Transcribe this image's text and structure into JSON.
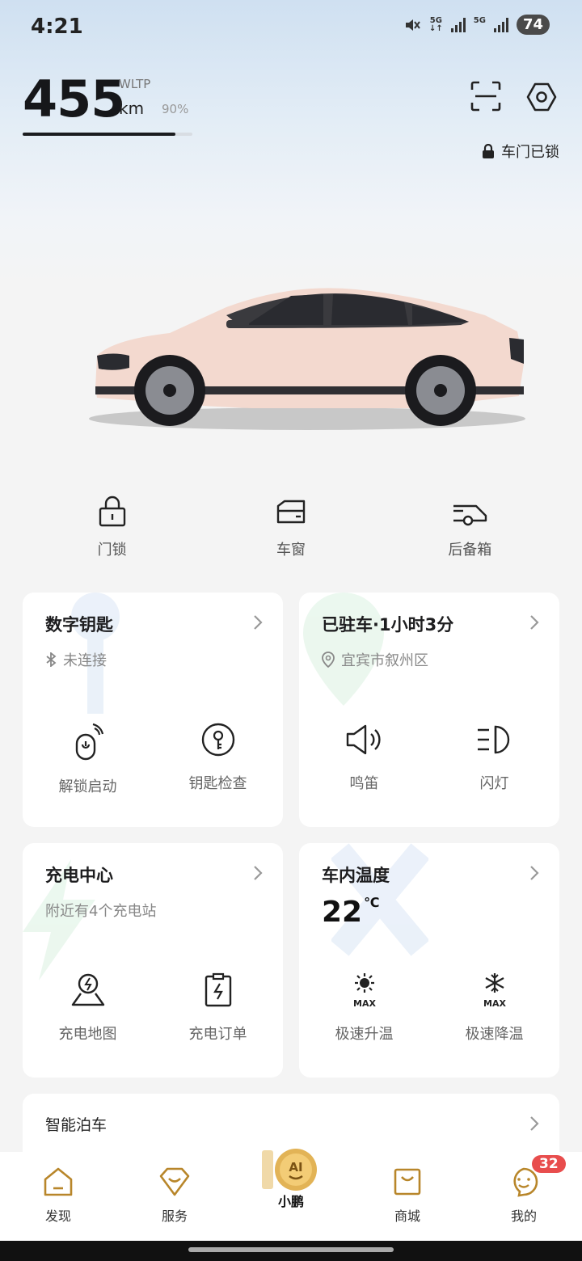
{
  "status": {
    "time": "4:21",
    "network1": "5G",
    "network2": "5G",
    "battery": "74"
  },
  "range": {
    "value": "455",
    "standard": "WLTP",
    "unit": "km",
    "percent": "90%",
    "fill": 0.9
  },
  "door_status": "车门已锁",
  "quick_controls": [
    {
      "label": "门锁",
      "icon": "lock-icon"
    },
    {
      "label": "车窗",
      "icon": "window-icon"
    },
    {
      "label": "后备箱",
      "icon": "trunk-icon"
    }
  ],
  "cards": {
    "digital_key": {
      "title": "数字钥匙",
      "status": "未连接",
      "actions": [
        {
          "label": "解锁启动",
          "icon": "remote-unlock-icon"
        },
        {
          "label": "钥匙检查",
          "icon": "key-check-icon"
        }
      ]
    },
    "parking": {
      "title": "已驻车·1小时3分",
      "location": "宜宾市叙州区",
      "actions": [
        {
          "label": "鸣笛",
          "icon": "horn-icon"
        },
        {
          "label": "闪灯",
          "icon": "headlight-icon"
        }
      ]
    },
    "charging": {
      "title": "充电中心",
      "subtitle": "附近有4个充电站",
      "actions": [
        {
          "label": "充电地图",
          "icon": "charging-map-icon"
        },
        {
          "label": "充电订单",
          "icon": "charging-order-icon"
        }
      ]
    },
    "climate": {
      "title": "车内温度",
      "temperature": "22",
      "temperature_unit": "℃",
      "actions": [
        {
          "label": "极速升温",
          "icon": "max-heat-icon",
          "badge": "MAX"
        },
        {
          "label": "极速降温",
          "icon": "max-cool-icon",
          "badge": "MAX"
        }
      ]
    },
    "smart_parking": {
      "title": "智能泊车"
    }
  },
  "nav": {
    "items": [
      {
        "label": "发现",
        "icon": "home-icon"
      },
      {
        "label": "服务",
        "icon": "service-icon"
      },
      {
        "label": "小鹏",
        "icon": "xpeng-ai-icon",
        "ai_text": "AI"
      },
      {
        "label": "商城",
        "icon": "shop-icon"
      },
      {
        "label": "我的",
        "icon": "profile-icon",
        "badge": "32"
      }
    ]
  },
  "colors": {
    "accent": "#b8862a",
    "badge": "#e84d4d",
    "car_body": "#f3d9cf"
  }
}
